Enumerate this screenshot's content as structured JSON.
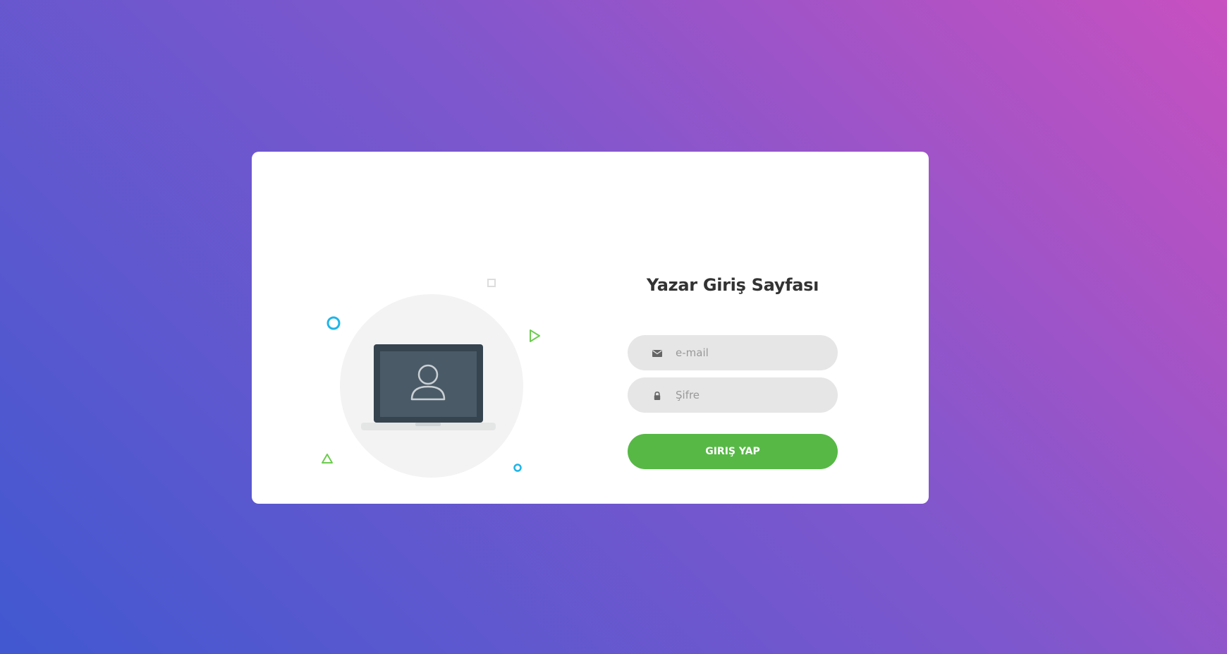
{
  "page": {
    "title": "Yazar Giriş Sayfası"
  },
  "form": {
    "email_placeholder": "e-mail",
    "password_placeholder": "Şifre",
    "submit_label": "GIRIŞ YAP"
  },
  "icons": {
    "email": "envelope-icon",
    "password": "lock-icon",
    "illustration": "laptop-user-icon"
  },
  "colors": {
    "gradient_start": "#4158d0",
    "gradient_end": "#c850c0",
    "button": "#57b846",
    "field_bg": "#e6e6e6",
    "title": "#333333"
  }
}
